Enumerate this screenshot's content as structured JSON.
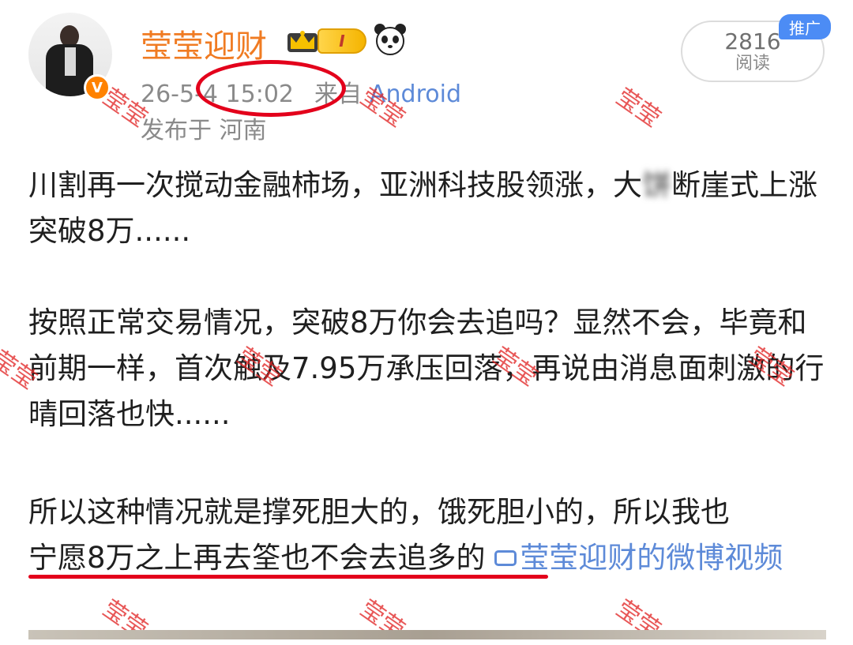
{
  "post": {
    "author": {
      "name": "莹莹迎财",
      "level_badge": "I",
      "avatar_icon": "avatar-woman-in-black-suit",
      "verified_icon": "orange-v-badge",
      "verified_glyph": "V"
    },
    "promo_tag": "推广",
    "reads": {
      "count": "2816",
      "label": "阅读"
    },
    "meta": {
      "time": "26-5-4 15:02",
      "from_label": "来自",
      "source": "Android",
      "location": "发布于 河南"
    },
    "content": {
      "p1_a": "川割再一次搅动金融柿场，亚洲科技股领涨，大",
      "p1_blur": "饼",
      "p1_b": "断崖式上涨突破8万......",
      "p2": "按照正常交易情况，突破8万你会去追吗？显然不会，毕竟和前期一样，首次触及7.95万承压回落，再说由消息面刺激的行晴回落也快......",
      "p3_a": "所以这种情况就是撑死胆大的，饿死胆小的，所以我也",
      "p3_underlined": "宁愿8万之上再去筌也不会去追多的",
      "p3_link": "莹莹迎财的微博视频"
    },
    "watermark": "莹莹"
  },
  "colors": {
    "accent_orange": "#f07b22",
    "link_blue": "#5d8ad8",
    "annotation_red": "#e3001b",
    "meta_gray": "#8a8a8a"
  }
}
